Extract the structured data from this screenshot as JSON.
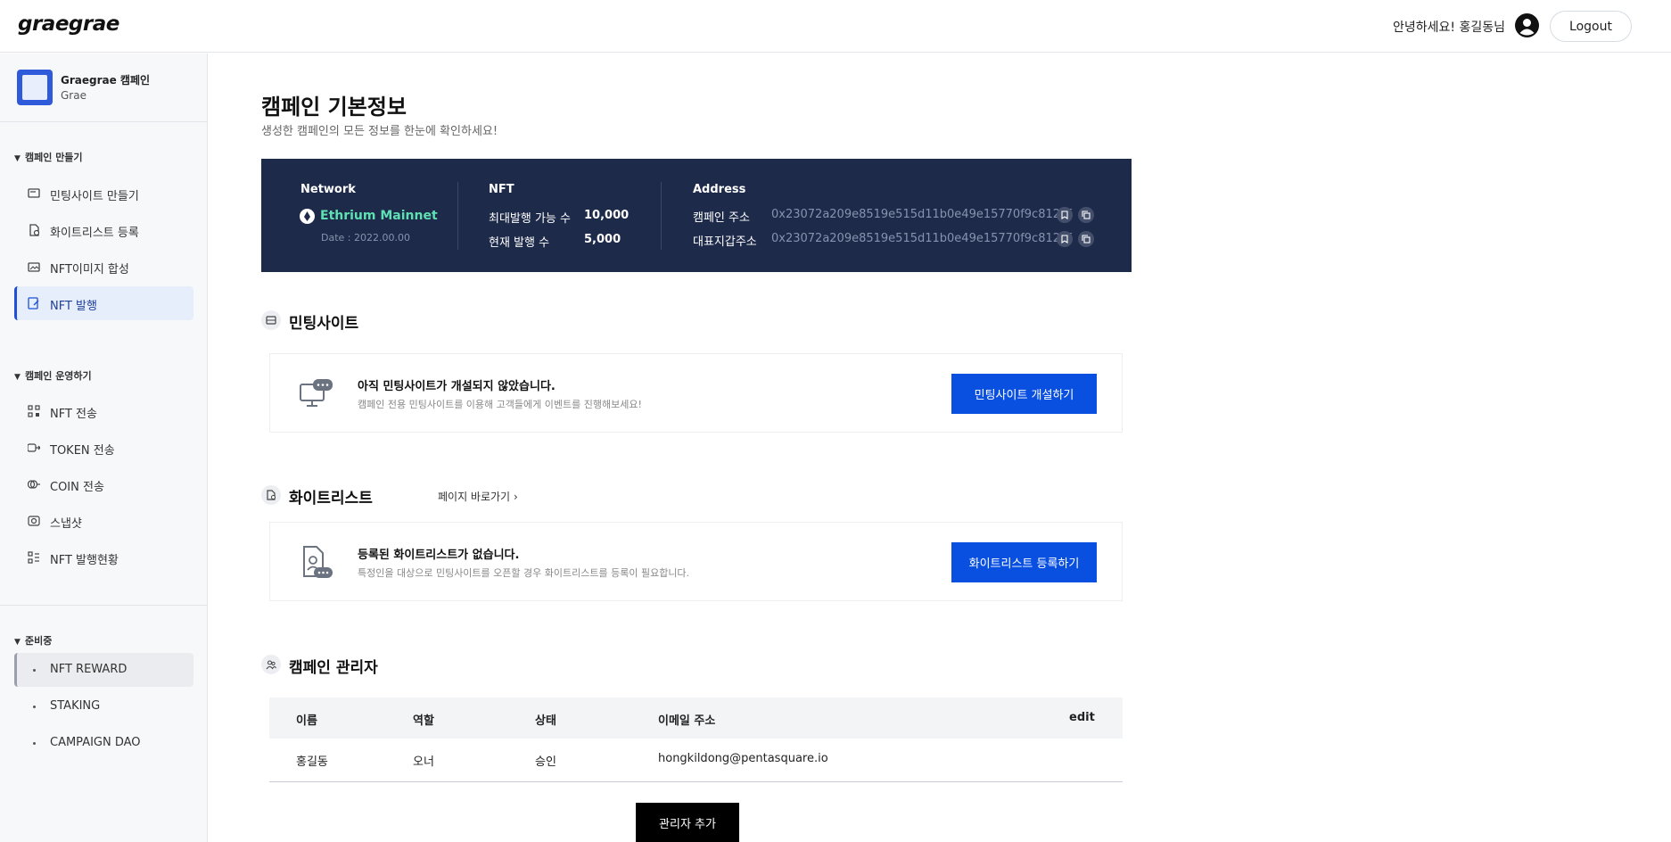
{
  "header": {
    "logo": "graegrae",
    "greeting": "안녕하세요! 홍길동님",
    "logout_label": "Logout"
  },
  "sidebar": {
    "campaign": {
      "name": "Graegrae 캠페인",
      "sub": "Grae"
    },
    "groups": [
      {
        "title": "캠페인 만들기",
        "items": [
          {
            "label": "민팅사이트 만들기",
            "icon": "minting-site-icon"
          },
          {
            "label": "화이트리스트 등록",
            "icon": "whitelist-icon"
          },
          {
            "label": "NFT이미지 합성",
            "icon": "image-compose-icon"
          },
          {
            "label": "NFT 발행",
            "icon": "nft-issue-icon",
            "active": true
          }
        ]
      },
      {
        "title": "캠페인 운영하기",
        "items": [
          {
            "label": "NFT 전송",
            "icon": "nft-transfer-icon"
          },
          {
            "label": "TOKEN 전송",
            "icon": "token-transfer-icon"
          },
          {
            "label": "COIN 전송",
            "icon": "coin-transfer-icon"
          },
          {
            "label": "스냅샷",
            "icon": "snapshot-icon"
          },
          {
            "label": "NFT 발행현황",
            "icon": "issue-status-icon"
          }
        ]
      },
      {
        "title": "준비중",
        "items": [
          {
            "label": "NFT REWARD"
          },
          {
            "label": "STAKING"
          },
          {
            "label": "CAMPAIGN DAO"
          }
        ]
      }
    ]
  },
  "main": {
    "title": "캠페인 기본정보",
    "subtitle": "생성한 캠페인의 모든 정보를 한눈에 확인하세요!",
    "info": {
      "network_heading": "Network",
      "network_name": "Ethrium Mainnet",
      "network_date": "Date : 2022.00.00",
      "nft_heading": "NFT",
      "max_label": "최대발행 가능 수",
      "max_value": "10,000",
      "current_label": "현재 발행 수",
      "current_value": "5,000",
      "address_heading": "Address",
      "campaign_addr_label": "캠페인 주소",
      "campaign_addr": "0x23072a209e8519e515d11b0e49e15770f9c812df",
      "wallet_addr_label": "대표지갑주소",
      "wallet_addr": "0x23072a209e8519e515d11b0e49e15770f9c812df"
    },
    "minting": {
      "title": "민팅사이트",
      "empty_title": "아직 민팅사이트가 개설되지 않았습니다.",
      "empty_desc": "캠페인 전용 민팅사이트를 이용해 고객들에게 이벤트를 진행해보세요!",
      "button": "민팅사이트 개설하기"
    },
    "whitelist": {
      "title": "화이트리스트",
      "link": "페이지 바로가기",
      "empty_title": "등록된 화이트리스트가 없습니다.",
      "empty_desc": "특정인을 대상으로 민팅사이트를 오픈할 경우 화이트리스트를 등록이 필요합니다.",
      "button": "화이트리스트 등록하기"
    },
    "admins": {
      "title": "캠페인 관리자",
      "columns": [
        "이름",
        "역할",
        "상태",
        "이메일 주소",
        "edit"
      ],
      "rows": [
        {
          "name": "홍길동",
          "role": "오너",
          "status": "승인",
          "email": "hongkildong@pentasquare.io"
        }
      ],
      "add_button": "관리자 추가"
    }
  },
  "colors": {
    "accent": "#0a50e0",
    "panel_bg": "#1d2a4a",
    "network_green": "#5ee0b3",
    "active_nav_bg": "#e6eefc"
  }
}
